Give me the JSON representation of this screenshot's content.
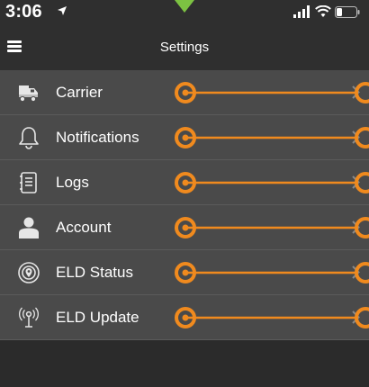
{
  "status_bar": {
    "time": "3:06",
    "icons": [
      "location-arrow-icon",
      "cellular-signal-icon",
      "wifi-icon",
      "battery-icon"
    ]
  },
  "nav": {
    "title": "Settings",
    "menu_icon": "hamburger-menu-icon"
  },
  "settings": {
    "items": [
      {
        "label": "Carrier",
        "icon": "truck-icon"
      },
      {
        "label": "Notifications",
        "icon": "bell-icon"
      },
      {
        "label": "Logs",
        "icon": "logbook-icon"
      },
      {
        "label": "Account",
        "icon": "person-icon"
      },
      {
        "label": "ELD Status",
        "icon": "eld-status-icon"
      },
      {
        "label": "ELD Update",
        "icon": "antenna-icon"
      }
    ]
  },
  "colors": {
    "background": "#2b2b2b",
    "row": "#4a4a4a",
    "annotation": "#f08a1e",
    "indicator": "#7cc242"
  }
}
